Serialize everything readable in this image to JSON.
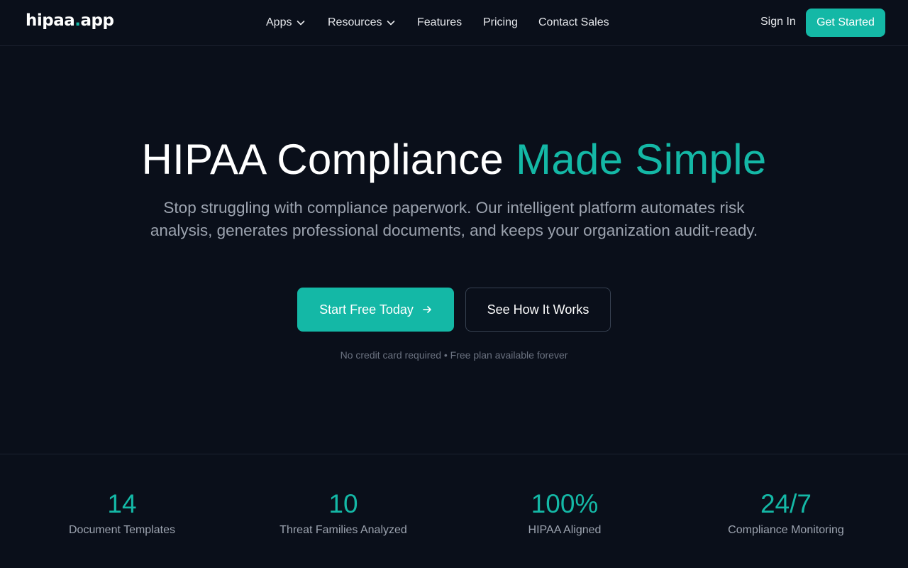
{
  "nav": {
    "logo_left": "hipaa",
    "logo_dot": ".",
    "logo_right": "app",
    "links": [
      {
        "label": "Apps",
        "dropdown": true
      },
      {
        "label": "Resources",
        "dropdown": true
      },
      {
        "label": "Features",
        "dropdown": false
      },
      {
        "label": "Pricing",
        "dropdown": false
      },
      {
        "label": "Contact Sales",
        "dropdown": false
      }
    ],
    "sign_in": "Sign In",
    "get_started": "Get Started"
  },
  "hero": {
    "title_main": "HIPAA Compliance ",
    "title_accent": "Made Simple",
    "subtitle": "Stop struggling with compliance paperwork. Our intelligent platform automates risk analysis, generates professional documents, and keeps your organization audit-ready.",
    "primary_cta": "Start Free Today",
    "secondary_cta": "See How It Works",
    "note": "No credit card required • Free plan available forever"
  },
  "stats": [
    {
      "value": "14",
      "label": "Document Templates"
    },
    {
      "value": "10",
      "label": "Threat Families Analyzed"
    },
    {
      "value": "100%",
      "label": "HIPAA Aligned"
    },
    {
      "value": "24/7",
      "label": "Compliance Monitoring"
    }
  ],
  "colors": {
    "background": "#0a0f1a",
    "accent": "#14b8a6",
    "muted_text": "#9ca3af"
  },
  "icons": {
    "dropdown": "chevron-down-icon",
    "cta_arrow": "arrow-right-icon"
  }
}
